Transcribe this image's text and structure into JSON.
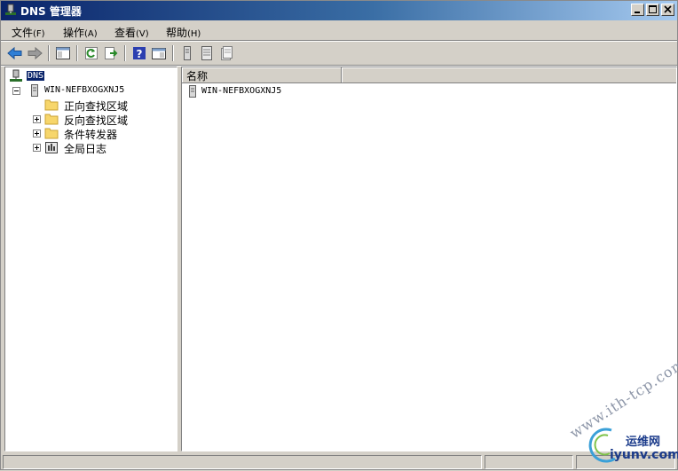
{
  "window": {
    "title": "DNS 管理器"
  },
  "menu": [
    {
      "label": "文件",
      "accel": "(F)"
    },
    {
      "label": "操作",
      "accel": "(A)"
    },
    {
      "label": "查看",
      "accel": "(V)"
    },
    {
      "label": "帮助",
      "accel": "(H)"
    }
  ],
  "toolbar": {
    "buttons": [
      "back-icon",
      "forward-icon",
      "console-tree-icon",
      "refresh-icon",
      "export-list-icon",
      "help-icon",
      "show-pane-icon",
      "server-icon",
      "list-view-icon",
      "properties-icon"
    ]
  },
  "tree": {
    "root": "DNS",
    "server": "WIN-NEFBXOGXNJ5",
    "nodes": [
      "正向查找区域",
      "反向查找区域",
      "条件转发器",
      "全局日志"
    ]
  },
  "list": {
    "column_name": "名称",
    "rows": [
      "WIN-NEFBXOGXNJ5"
    ]
  },
  "watermark": {
    "site": "www.ith-tcp.com",
    "brand_cn": "运维网",
    "brand_domain": "iyunv.com"
  }
}
